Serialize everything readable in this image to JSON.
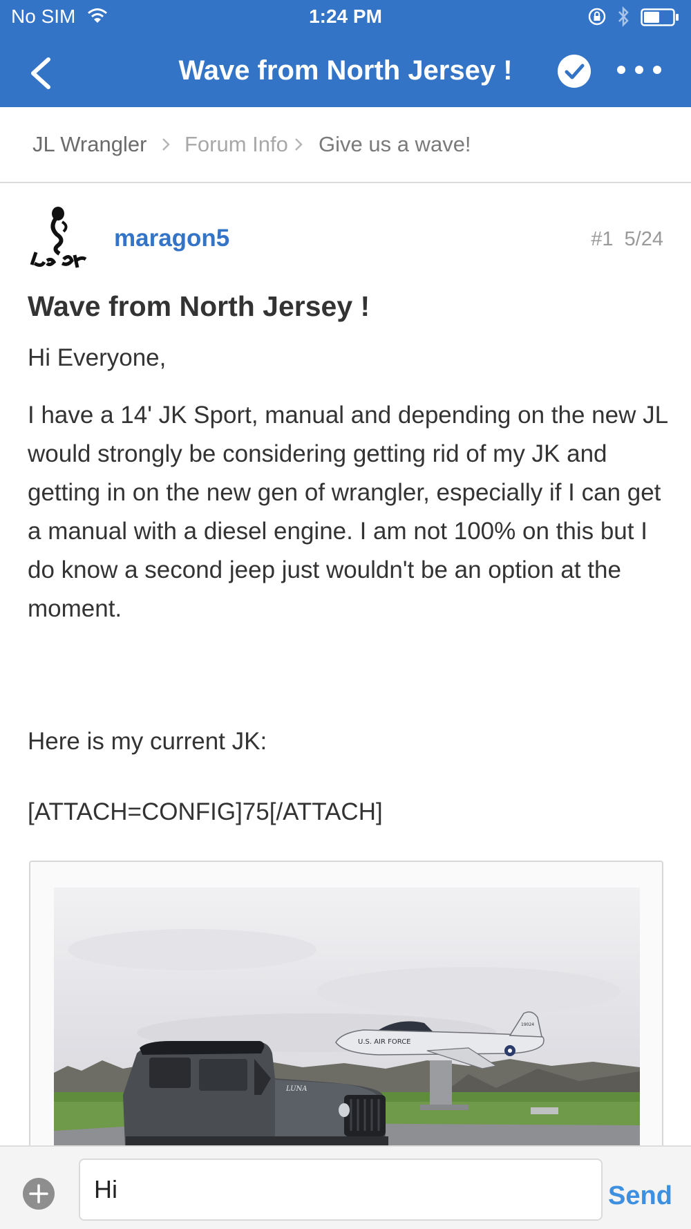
{
  "status_bar": {
    "carrier": "No SIM",
    "time": "1:24 PM",
    "icons": [
      "wifi-icon",
      "orientation-lock-icon",
      "bluetooth-icon",
      "battery-icon"
    ]
  },
  "nav": {
    "title": "Wave from North Jersey !",
    "icons": [
      "back-chevron-icon",
      "check-circle-icon",
      "more-dots-icon"
    ]
  },
  "breadcrumb": {
    "items": [
      "JL Wrangler",
      "Forum Info",
      "Give us a wave!"
    ]
  },
  "post": {
    "username": "maragon5",
    "number": "#1",
    "date": "5/24",
    "avatar_icon": "jeep-avatar-icon",
    "title": "Wave from North Jersey !",
    "greeting": "Hi Everyone,",
    "body": "I have a 14' JK Sport, manual and depending on the new JL would strongly be considering getting rid of my JK and getting in on the new gen of wrangler, especially if I can get a manual with a diesel engine. I am not 100% on this but I do know a second jeep just wouldn't be an option at the moment.",
    "here": "Here is my current JK:",
    "attach": "[ATTACH=CONFIG]75[/ATTACH]",
    "photo": {
      "plane_text": "U.S. AIR FORCE",
      "plane_tail": "19024",
      "jeep_text": "LUNA"
    }
  },
  "composer": {
    "input_value": "Hi",
    "send_label": "Send",
    "icons": [
      "plus-circle-icon"
    ]
  },
  "colors": {
    "brand_blue": "#3374c7",
    "link_blue": "#3374c7",
    "send_blue": "#3d8fe0"
  }
}
